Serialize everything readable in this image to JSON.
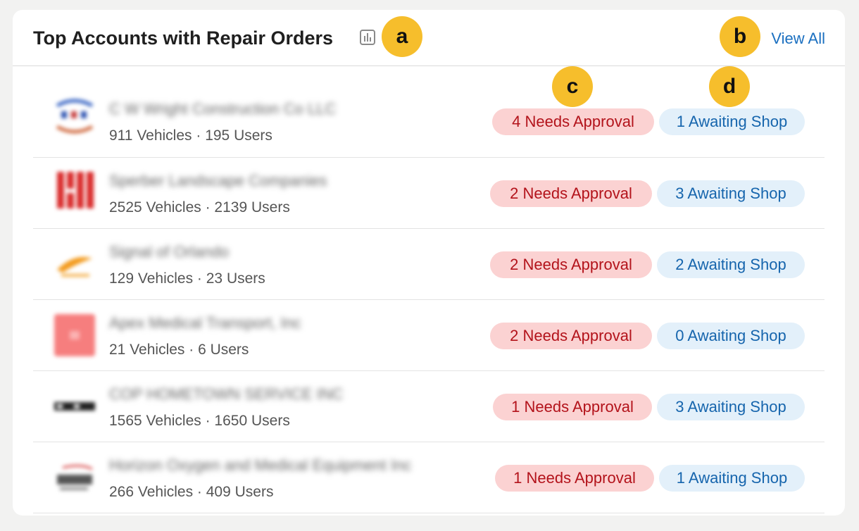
{
  "header": {
    "title": "Top Accounts with Repair Orders",
    "chart_icon": "bar-chart-icon",
    "view_all_label": "View All"
  },
  "markers": {
    "a": "a",
    "b": "b",
    "c": "c",
    "d": "d"
  },
  "accounts": [
    {
      "name": "C W Wright Construction Co LLC",
      "meta": "911 Vehicles · 195 Users",
      "needs_approval": "4 Needs Approval",
      "awaiting_shop": "1 Awaiting Shop"
    },
    {
      "name": "Sperber Landscape Companies",
      "meta": "2525 Vehicles · 2139 Users",
      "needs_approval": "2 Needs Approval",
      "awaiting_shop": "3 Awaiting Shop"
    },
    {
      "name": "Signal of Orlando",
      "meta": "129 Vehicles · 23 Users",
      "needs_approval": "2 Needs Approval",
      "awaiting_shop": "2 Awaiting Shop"
    },
    {
      "name": "Apex Medical Transport, Inc",
      "meta": "21 Vehicles · 6 Users",
      "needs_approval": "2 Needs Approval",
      "awaiting_shop": "0 Awaiting Shop"
    },
    {
      "name": "COP HOMETOWN SERVICE INC",
      "meta": "1565 Vehicles · 1650 Users",
      "needs_approval": "1 Needs Approval",
      "awaiting_shop": "3 Awaiting Shop"
    },
    {
      "name": "Horizon Oxygen and Medical Equipment Inc",
      "meta": "266 Vehicles · 409 Users",
      "needs_approval": "1 Needs Approval",
      "awaiting_shop": "1 Awaiting Shop"
    }
  ],
  "colors": {
    "approval_bg": "#fbd2d2",
    "approval_text": "#b3131b",
    "shop_bg": "#e3f0fa",
    "shop_text": "#1665ad",
    "link": "#1a6fc0",
    "marker": "#f6be2c"
  }
}
